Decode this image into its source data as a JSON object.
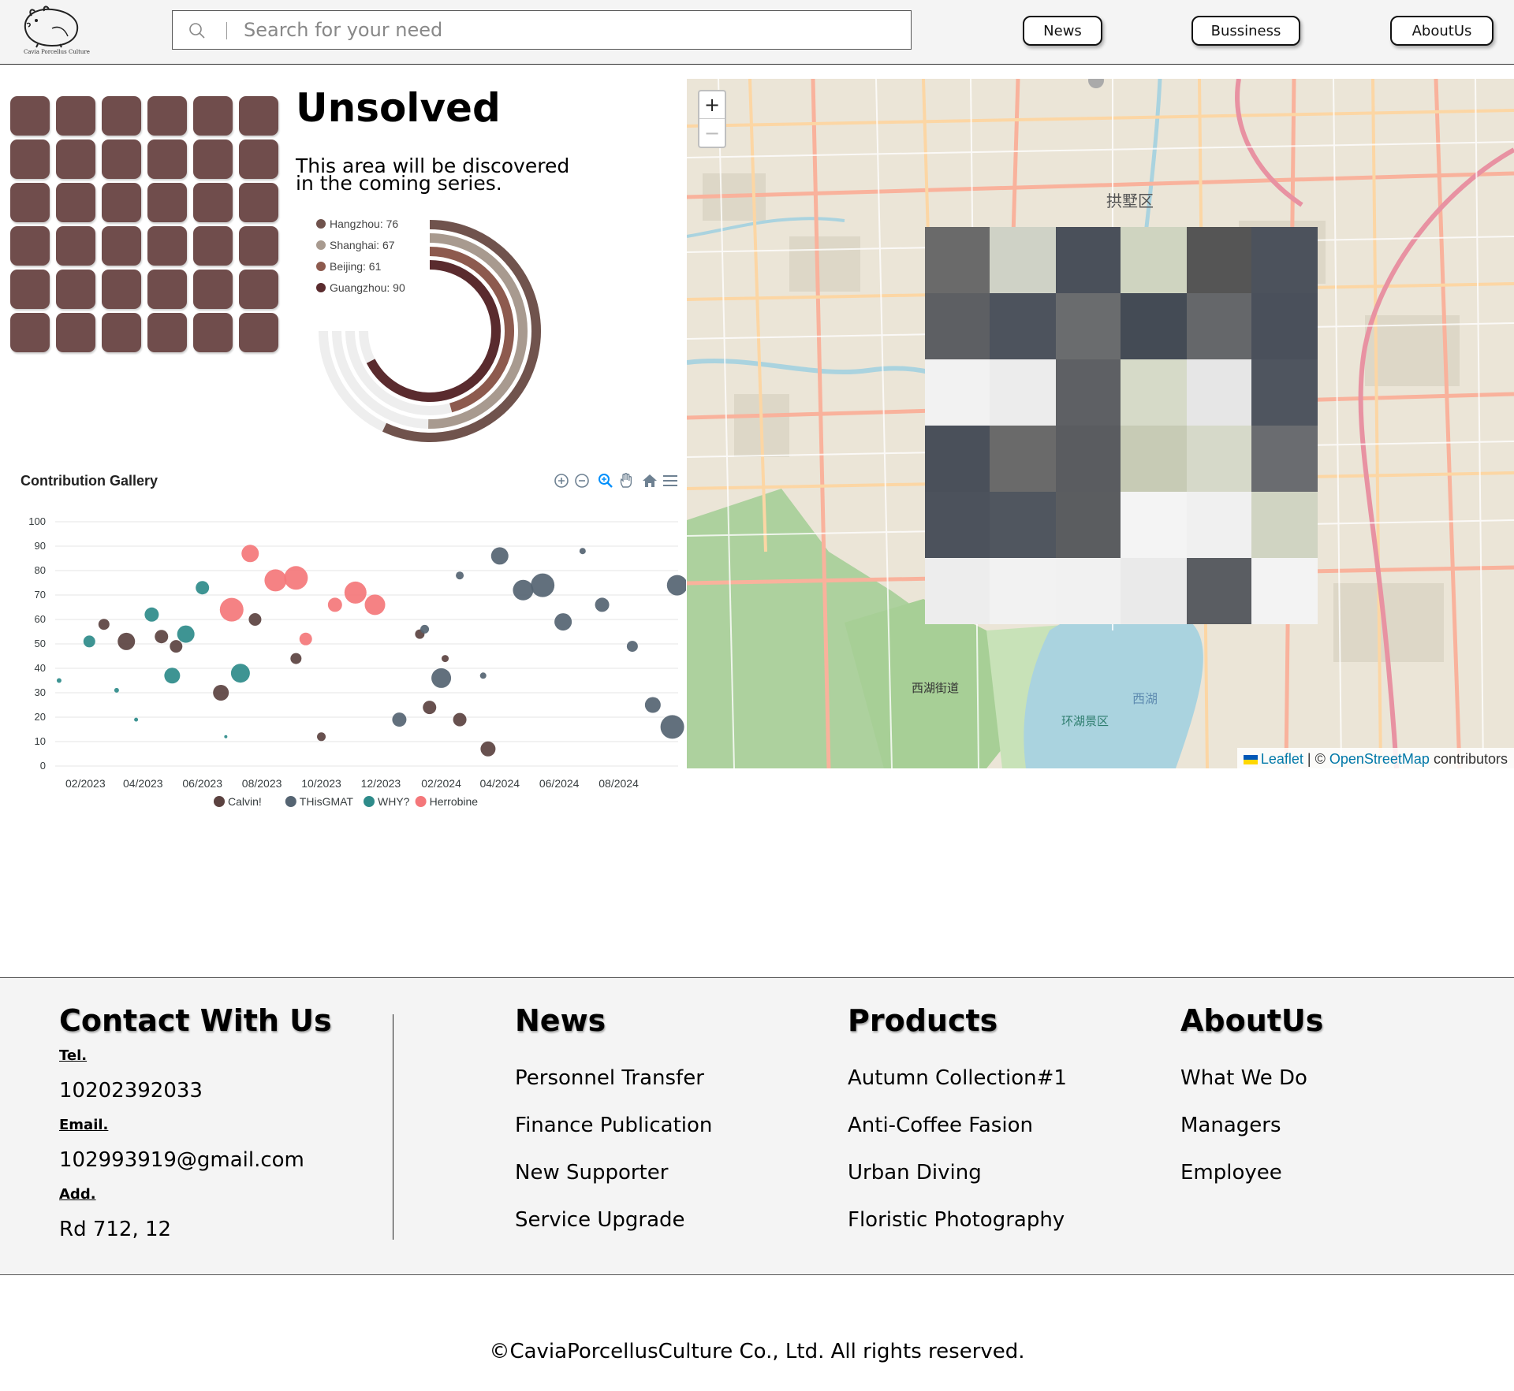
{
  "header": {
    "logo_text": "Cavia Porcellus Culture",
    "search_placeholder": "Search for your need",
    "nav": [
      {
        "label": "News"
      },
      {
        "label": "Bussiness"
      },
      {
        "label": "AboutUs"
      }
    ]
  },
  "unsolved": {
    "title": "Unsolved",
    "description": "This area will be discovered in the coming series.",
    "grid_color": "#704d4c",
    "grid_rows": 6,
    "grid_cols": 6
  },
  "radial_chart": {
    "type": "radialBar",
    "items": [
      {
        "label": "Hangzhou",
        "value": 76,
        "color": "#70534d"
      },
      {
        "label": "Shanghai",
        "value": 67,
        "color": "#a89a8f"
      },
      {
        "label": "Beijing",
        "value": 61,
        "color": "#8d5a4e"
      },
      {
        "label": "Guangzhou",
        "value": 90,
        "color": "#5a2b2e"
      }
    ]
  },
  "chart_data": {
    "type": "scatter",
    "title": "Contribution Gallery",
    "x_ticks": [
      "02/2023",
      "04/2023",
      "06/2023",
      "08/2023",
      "10/2023",
      "12/2023",
      "02/2024",
      "04/2024",
      "06/2024",
      "08/2024"
    ],
    "y_ticks": [
      0,
      10,
      20,
      30,
      40,
      50,
      60,
      70,
      80,
      90,
      100
    ],
    "ylim": [
      0,
      100
    ],
    "xlim": [
      "2023-01-01",
      "2024-10-01"
    ],
    "legend_position": "bottom",
    "series": [
      {
        "name": "Calvin!",
        "color": "#5b4240",
        "points": [
          {
            "x": "2023-02-20",
            "y": 58,
            "z": 12
          },
          {
            "x": "2023-03-15",
            "y": 51,
            "z": 20
          },
          {
            "x": "2023-04-20",
            "y": 53,
            "z": 15
          },
          {
            "x": "2023-05-05",
            "y": 49,
            "z": 14
          },
          {
            "x": "2023-06-20",
            "y": 30,
            "z": 18
          },
          {
            "x": "2023-07-25",
            "y": 60,
            "z": 14
          },
          {
            "x": "2023-09-05",
            "y": 44,
            "z": 12
          },
          {
            "x": "2023-10-01",
            "y": 12,
            "z": 9
          },
          {
            "x": "2024-01-10",
            "y": 54,
            "z": 10
          },
          {
            "x": "2024-01-20",
            "y": 24,
            "z": 15
          },
          {
            "x": "2024-02-05",
            "y": 44,
            "z": 7
          },
          {
            "x": "2024-02-20",
            "y": 19,
            "z": 15
          },
          {
            "x": "2024-03-20",
            "y": 7,
            "z": 17
          }
        ]
      },
      {
        "name": "THisGMAT",
        "color": "#556472",
        "points": [
          {
            "x": "2023-12-20",
            "y": 19,
            "z": 16
          },
          {
            "x": "2024-01-15",
            "y": 56,
            "z": 9
          },
          {
            "x": "2024-02-01",
            "y": 36,
            "z": 23
          },
          {
            "x": "2024-02-20",
            "y": 78,
            "z": 8
          },
          {
            "x": "2024-03-15",
            "y": 37,
            "z": 6
          },
          {
            "x": "2024-04-01",
            "y": 86,
            "z": 20
          },
          {
            "x": "2024-04-25",
            "y": 72,
            "z": 24
          },
          {
            "x": "2024-05-15",
            "y": 74,
            "z": 28
          },
          {
            "x": "2024-06-05",
            "y": 59,
            "z": 20
          },
          {
            "x": "2024-06-25",
            "y": 88,
            "z": 6
          },
          {
            "x": "2024-07-15",
            "y": 66,
            "z": 16
          },
          {
            "x": "2024-08-15",
            "y": 49,
            "z": 12
          },
          {
            "x": "2024-09-05",
            "y": 25,
            "z": 18
          },
          {
            "x": "2024-09-25",
            "y": 16,
            "z": 28
          },
          {
            "x": "2024-09-30",
            "y": 74,
            "z": 24
          }
        ]
      },
      {
        "name": "WHY?",
        "color": "#2e8b8a",
        "points": [
          {
            "x": "2023-01-05",
            "y": 35,
            "z": 4
          },
          {
            "x": "2023-02-05",
            "y": 51,
            "z": 13
          },
          {
            "x": "2023-03-05",
            "y": 31,
            "z": 4
          },
          {
            "x": "2023-03-25",
            "y": 19,
            "z": 3
          },
          {
            "x": "2023-04-10",
            "y": 62,
            "z": 16
          },
          {
            "x": "2023-05-01",
            "y": 37,
            "z": 18
          },
          {
            "x": "2023-05-15",
            "y": 54,
            "z": 20
          },
          {
            "x": "2023-06-01",
            "y": 73,
            "z": 15
          },
          {
            "x": "2023-07-10",
            "y": 38,
            "z": 22
          },
          {
            "x": "2023-06-25",
            "y": 12,
            "z": 2
          }
        ]
      },
      {
        "name": "Herrobine",
        "color": "#f4777a",
        "points": [
          {
            "x": "2023-07-01",
            "y": 64,
            "z": 28
          },
          {
            "x": "2023-07-20",
            "y": 87,
            "z": 20
          },
          {
            "x": "2023-08-15",
            "y": 76,
            "z": 26
          },
          {
            "x": "2023-09-05",
            "y": 77,
            "z": 28
          },
          {
            "x": "2023-09-15",
            "y": 52,
            "z": 14
          },
          {
            "x": "2023-10-15",
            "y": 66,
            "z": 16
          },
          {
            "x": "2023-11-05",
            "y": 71,
            "z": 26
          },
          {
            "x": "2023-11-25",
            "y": 66,
            "z": 24
          }
        ]
      }
    ]
  },
  "map": {
    "zoom_in": "+",
    "zoom_out": "−",
    "attribution_leaflet": "Leaflet",
    "attribution_sep": " | © ",
    "attribution_osm": "OpenStreetMap",
    "attribution_tail": " contributors",
    "labels": [
      "拱墅区",
      "西湖",
      "西湖街道",
      "环湖景区"
    ]
  },
  "footer": {
    "contact": {
      "heading": "Contact With Us",
      "tel_label": "Tel.",
      "tel": "10202392033",
      "email_label": "Email.",
      "email": "102993919@gmail.com",
      "add_label": "Add.",
      "add": "Rd 712, 12"
    },
    "news": {
      "heading": "News",
      "links": [
        "Personnel Transfer",
        "Finance Publication",
        "New Supporter",
        "Service Upgrade"
      ]
    },
    "products": {
      "heading": "Products",
      "links": [
        "Autumn Collection#1",
        "Anti-Coffee Fasion",
        "Urban Diving",
        "Floristic Photography"
      ]
    },
    "about": {
      "heading": "AboutUs",
      "links": [
        "What We Do",
        "Managers",
        "Employee"
      ]
    }
  },
  "copyright": "©CaviaPorcellusCulture Co., Ltd. All rights reserved."
}
